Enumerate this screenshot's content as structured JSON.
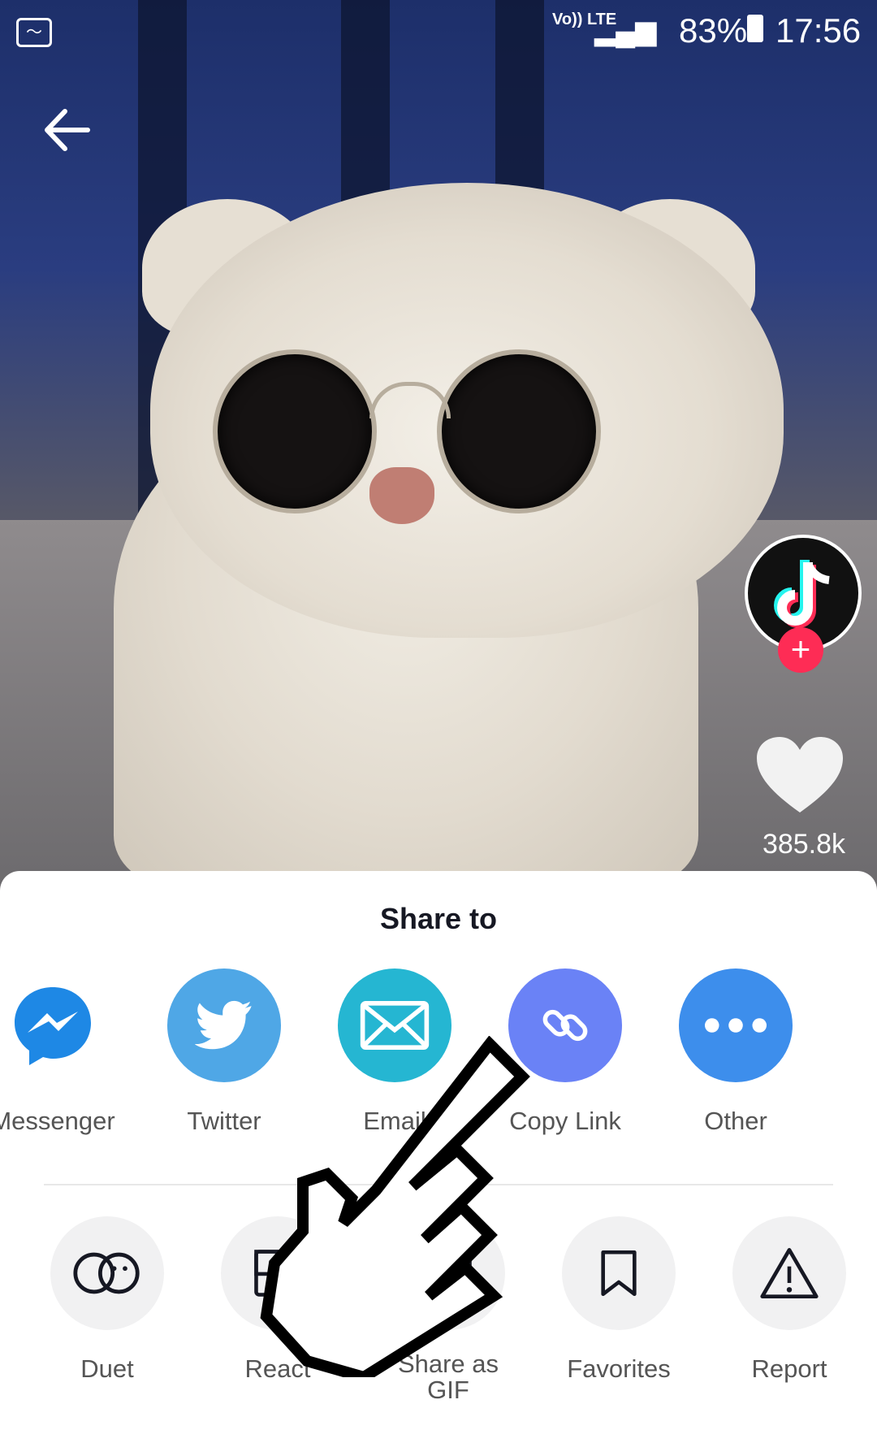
{
  "status_bar": {
    "network": "Vo)) LTE",
    "battery_percent": "83%",
    "time": "17:56"
  },
  "video": {
    "likes": "385.8k",
    "follow_symbol": "+"
  },
  "share_sheet": {
    "title": "Share to",
    "share_targets": [
      {
        "label": "Messenger",
        "icon": "messenger-icon",
        "color": "#1e88e5"
      },
      {
        "label": "Twitter",
        "icon": "twitter-icon",
        "color": "#4fa7e6"
      },
      {
        "label": "Email",
        "icon": "email-icon",
        "color": "#25b6d2"
      },
      {
        "label": "Copy Link",
        "icon": "link-icon",
        "color": "#6a82f6"
      },
      {
        "label": "Other",
        "icon": "more-icon",
        "color": "#3d8eec"
      }
    ],
    "actions": [
      {
        "label": "Duet",
        "icon": "duet-icon"
      },
      {
        "label": "React",
        "icon": "react-icon"
      },
      {
        "label": "Share as GIF",
        "icon": "gif-icon"
      },
      {
        "label": "Favorites",
        "icon": "bookmark-icon"
      },
      {
        "label": "Report",
        "icon": "warning-icon"
      }
    ]
  }
}
